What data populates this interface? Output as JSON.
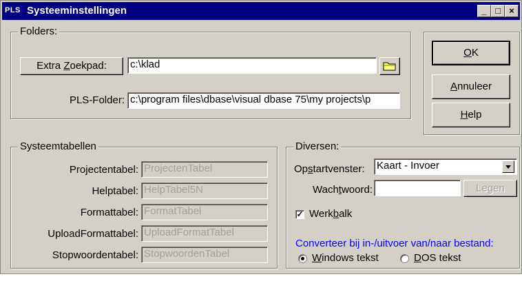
{
  "window": {
    "app_icon": "PLS",
    "title": "Systeeminstellingen",
    "controls": [
      "_",
      "□",
      "×"
    ]
  },
  "folders": {
    "legend": "Folders:",
    "extra_button_pre": "Extra ",
    "extra_button_ul": "Z",
    "extra_button_post": "oekpad:",
    "extra_value": "c:\\klad",
    "pls_label": "PLS-Folder:",
    "pls_value": "c:\\program files\\dbase\\visual dbase 75\\my projects\\p"
  },
  "buttons": {
    "ok_ul": "O",
    "ok_rest": "K",
    "cancel_ul": "A",
    "cancel_rest": "nnuleer",
    "help_ul": "H",
    "help_rest": "elp"
  },
  "systemtables": {
    "legend": "Systeemtabellen",
    "rows": [
      {
        "label": "Projectentabel:",
        "value": "ProjectenTabel"
      },
      {
        "label": "Helptabel:",
        "value": "HelpTabel5N"
      },
      {
        "label": "Formattabel:",
        "value": "FormatTabel"
      },
      {
        "label": "UploadFormattabel:",
        "value": "UploadFormatTabel"
      },
      {
        "label": "Stopwoordentabel:",
        "value": "StopwoordenTabel"
      }
    ]
  },
  "diversen": {
    "legend": "Diversen:",
    "startup_pre": "Op",
    "startup_ul": "s",
    "startup_post": "tartvenster:",
    "startup_value": "Kaart - Invoer",
    "password_pre": "Wach",
    "password_ul": "t",
    "password_post": "woord:",
    "password_value": "",
    "clear_button": "Legen",
    "toolbar_check_mark": "✓",
    "toolbar_pre": "Werk",
    "toolbar_ul": "b",
    "toolbar_post": "alk",
    "toolbar_checked": true,
    "convert_text": "Converteer bij in-/uitvoer van/naar bestand:",
    "radio_windows_ul": "W",
    "radio_windows_rest": "indows tekst",
    "radio_dos_ul": "D",
    "radio_dos_rest": "OS tekst",
    "selected": "windows"
  }
}
